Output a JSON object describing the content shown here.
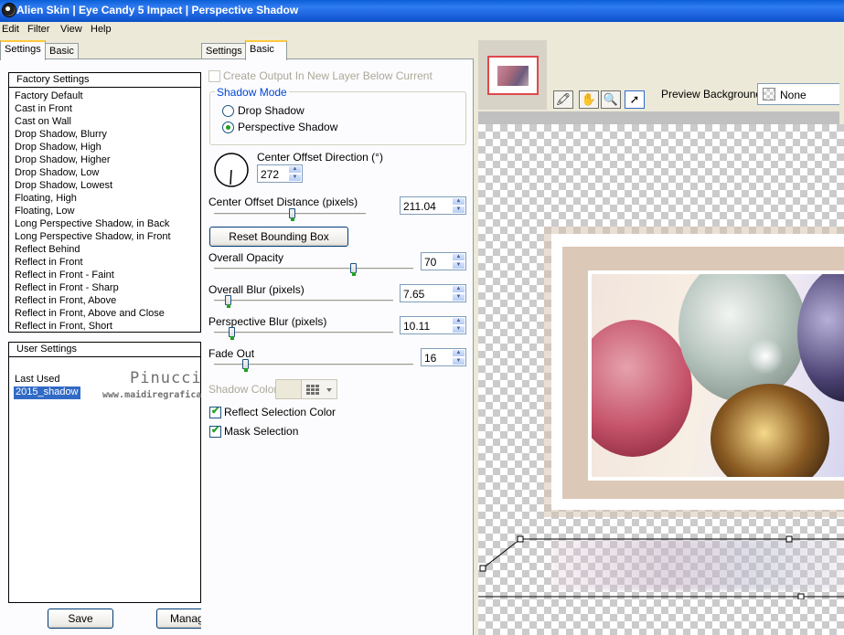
{
  "window": {
    "title": "Alien Skin  |  Eye Candy 5 Impact  |  Perspective Shadow"
  },
  "menu": [
    "Edit",
    "Filter",
    "View",
    "Help"
  ],
  "left_tabs": {
    "settings": "Settings",
    "basic": "Basic"
  },
  "factory_settings": {
    "header": "Factory Settings",
    "items": [
      "Factory Default",
      "Cast in Front",
      "Cast on Wall",
      "Drop Shadow, Blurry",
      "Drop Shadow, High",
      "Drop Shadow, Higher",
      "Drop Shadow, Low",
      "Drop Shadow, Lowest",
      "Floating, High",
      "Floating, Low",
      "Long Perspective Shadow, in Back",
      "Long Perspective Shadow, in Front",
      "Reflect Behind",
      "Reflect in Front",
      "Reflect in Front - Faint",
      "Reflect in Front - Sharp",
      "Reflect in Front, Above",
      "Reflect in Front, Above and Close",
      "Reflect in Front, Short"
    ]
  },
  "user_settings": {
    "header": "User Settings",
    "items": [
      "Last Used",
      "2015_shadow"
    ],
    "selected": "2015_shadow"
  },
  "watermark": {
    "name": "Pinuccia",
    "site": "www.maidiregrafica"
  },
  "left_buttons": {
    "save": "Save",
    "manage": "Manag"
  },
  "mid_tabs": {
    "settings": "Settings",
    "basic": "Basic"
  },
  "basic": {
    "create_output_label": "Create Output In New Layer Below Current",
    "shadow_mode": {
      "legend": "Shadow Mode",
      "options": [
        "Drop Shadow",
        "Perspective Shadow"
      ],
      "selected": "Perspective Shadow"
    },
    "center_offset_direction": {
      "label": "Center Offset Direction (°)",
      "value": "272"
    },
    "center_offset_distance": {
      "label": "Center Offset Distance (pixels)",
      "value": "211.04",
      "level": 0.52
    },
    "reset_button": "Reset Bounding Box",
    "overall_opacity": {
      "label": "Overall Opacity",
      "value": "70",
      "level": 0.7
    },
    "overall_blur": {
      "label": "Overall Blur (pixels)",
      "value": "7.65",
      "level": 0.08
    },
    "perspective_blur": {
      "label": "Perspective Blur (pixels)",
      "value": "10.11",
      "level": 0.1
    },
    "fade_out": {
      "label": "Fade Out",
      "value": "16",
      "level": 0.16
    },
    "shadow_color_label": "Shadow Color",
    "reflect_selection_color": {
      "label": "Reflect Selection Color",
      "checked": true
    },
    "mask_selection": {
      "label": "Mask Selection",
      "checked": true
    }
  },
  "preview": {
    "background_label": "Preview Background:",
    "background_value": "None"
  },
  "colors": {
    "accent": "#316ac5",
    "title_bar": "#1d63de",
    "green_check": "#21a121"
  }
}
